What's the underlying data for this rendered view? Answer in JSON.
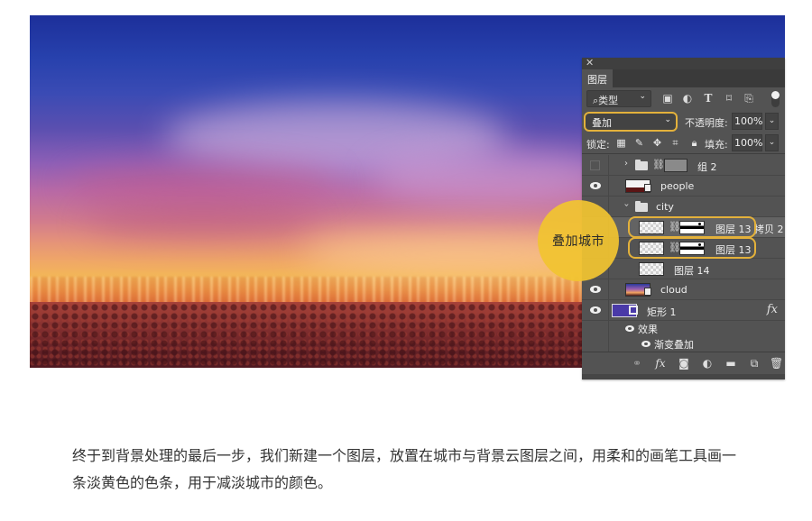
{
  "photo": {
    "description": "sunset sky over city with crowd"
  },
  "layers_panel": {
    "close_icon": "close-icon",
    "tab_label": "图层",
    "filter": {
      "search_icon": "search-icon",
      "kind_label": "类型",
      "icons": [
        "image-filter-icon",
        "adjustment-filter-icon",
        "type-filter-icon",
        "shape-filter-icon",
        "smart-object-filter-icon",
        "filter-toggle-icon"
      ]
    },
    "blend_mode": "叠加",
    "opacity_label": "不透明度:",
    "opacity_value": "100%",
    "lock_label": "锁定:",
    "fill_label": "填充:",
    "fill_value": "100%",
    "layers": [
      {
        "name": "组 2",
        "type": "group",
        "visible": false,
        "expanded": false
      },
      {
        "name": "people",
        "type": "smart-object",
        "visible": true
      },
      {
        "name": "city",
        "type": "group",
        "visible": true,
        "expanded": true
      },
      {
        "name": "图层 13 拷贝 2",
        "type": "masked-layer",
        "visible": true,
        "highlighted": true
      },
      {
        "name": "图层 13",
        "type": "masked-layer",
        "visible": true,
        "highlighted": true
      },
      {
        "name": "图层 14",
        "type": "layer",
        "visible": false
      },
      {
        "name": "cloud",
        "type": "smart-object",
        "visible": true
      },
      {
        "name": "矩形 1",
        "type": "shape",
        "visible": true,
        "has_fx": true,
        "fx_label": "fx"
      },
      {
        "name": "效果",
        "type": "effects-header",
        "visible": true
      },
      {
        "name": "渐变叠加",
        "type": "effect",
        "visible": true
      }
    ],
    "footer_icons": [
      "link-layers-icon",
      "fx-icon",
      "add-mask-icon",
      "adjustment-layer-icon",
      "new-group-icon",
      "new-layer-icon",
      "delete-layer-icon"
    ],
    "footer_fx_label": "fx"
  },
  "callout": {
    "text": "叠加城市",
    "color": "#f1c430"
  },
  "article": {
    "paragraph": "终于到背景处理的最后一步，我们新建一个图层，放置在城市与背景云图层之间，用柔和的画笔工具画一条淡黄色的色条，用于减淡城市的颜色。"
  },
  "colors": {
    "highlight": "#e3b13b",
    "panel_bg": "#535353"
  }
}
